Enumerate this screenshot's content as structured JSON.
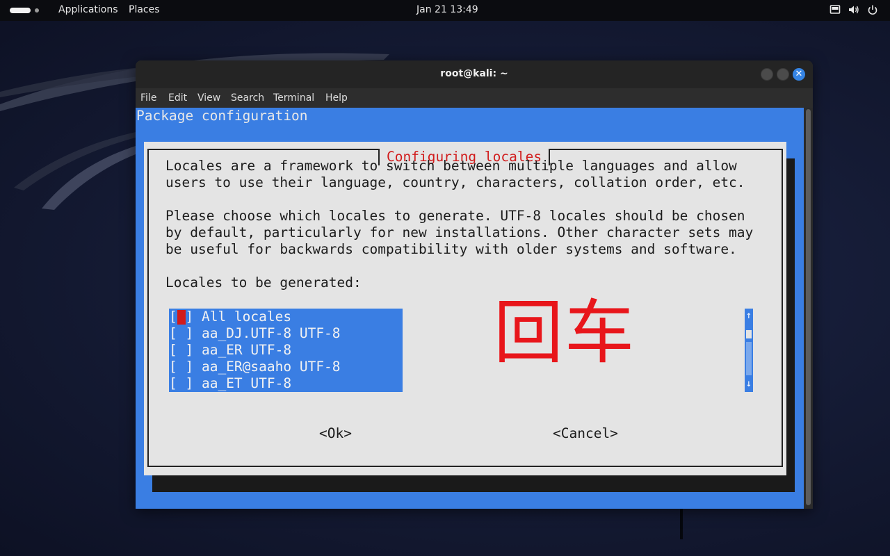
{
  "topbar": {
    "applications_label": "Applications",
    "places_label": "Places",
    "clock": "Jan 21  13:49"
  },
  "window": {
    "title": "root@kali: ~",
    "menu": [
      "File",
      "Edit",
      "View",
      "Search",
      "Terminal",
      "Help"
    ]
  },
  "terminal": {
    "header": "Package configuration",
    "dialog": {
      "title": "Configuring locales",
      "text_lines": [
        "Locales are a framework to switch between multiple languages and allow",
        "users to use their language, country, characters, collation order, etc.",
        "",
        "Please choose which locales to generate. UTF-8 locales should be chosen",
        "by default, particularly for new installations. Other character sets may",
        "be useful for backwards compatibility with older systems and software.",
        "",
        "Locales to be generated:"
      ],
      "list": [
        "[ ] All locales",
        "[ ] aa_DJ.UTF-8 UTF-8",
        "[ ] aa_ER UTF-8",
        "[ ] aa_ER@saaho UTF-8",
        "[ ] aa_ET UTF-8"
      ],
      "ok_label": "<Ok>",
      "cancel_label": "<Cancel>"
    },
    "annotation": "回车"
  },
  "colors": {
    "terminal_bg": "#3a7ee3",
    "dialog_bg": "#e4e4e4",
    "dialog_title": "#d11b1b",
    "annotation": "#e8161b",
    "accent_close": "#3584e4"
  },
  "icons": [
    "activities-icon",
    "screen-icon",
    "volume-icon",
    "power-icon",
    "close-icon",
    "arrow-up-icon",
    "arrow-down-icon"
  ]
}
